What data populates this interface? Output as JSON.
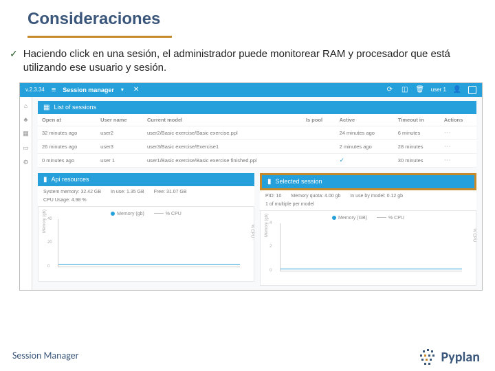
{
  "slide": {
    "title": "Consideraciones",
    "bullet": "Haciendo click en una sesión, el administrador puede monitorear RAM y procesador que está utilizando ese usuario y sesión.",
    "footer": "Session Manager",
    "logo_text": "Pyplan"
  },
  "topbar": {
    "version": "v.2.3.34",
    "title": "Session manager",
    "user": "user 1"
  },
  "panels": {
    "list_title": "List of sessions",
    "api_title": "Api resources",
    "selected_title": "Selected session"
  },
  "table": {
    "headers": [
      "Open at",
      "User name",
      "Current model",
      "Is pool",
      "Active",
      "Timeout in",
      "Actions"
    ],
    "rows": [
      {
        "open": "32 minutes ago",
        "user": "user2",
        "model": "user2/Basic exercise/Basic exercise.ppl",
        "pool": "",
        "active": "24 minutes ago",
        "timeout": "6 minutes"
      },
      {
        "open": "26 minutes ago",
        "user": "user3",
        "model": "user3/Basic exercise/Exercise1",
        "pool": "",
        "active": "2 minutes ago",
        "timeout": "28 minutes"
      },
      {
        "open": "0 minutes ago",
        "user": "user 1",
        "model": "user1/Basic exercise/Basic exercise finished.ppl",
        "pool": "",
        "active": "✓",
        "timeout": "30 minutes"
      }
    ]
  },
  "stats_left": {
    "mem": "System memory: 32.42 GB",
    "cpu": "CPU Usage: 4.98 %",
    "inuse": "In use: 1.35 GB",
    "free": "Free: 31.07 GB"
  },
  "stats_right": {
    "pid": "PID: 10",
    "detail": "1 of multiple per model",
    "quota": "Memory quota: 4.00 gb",
    "inuse": "In use by model: 0.12 gb"
  },
  "legend": {
    "mem": "Memory (gb)",
    "cpu": "% CPU",
    "mem2": "Memory (GB)",
    "cpu2": "% CPU"
  },
  "axes": {
    "left_label": "Memory (gb)",
    "right_label": "% CPU",
    "ticks_left": [
      "40",
      "20",
      "0"
    ],
    "ticks_right": [
      "4",
      "2",
      "0"
    ]
  }
}
